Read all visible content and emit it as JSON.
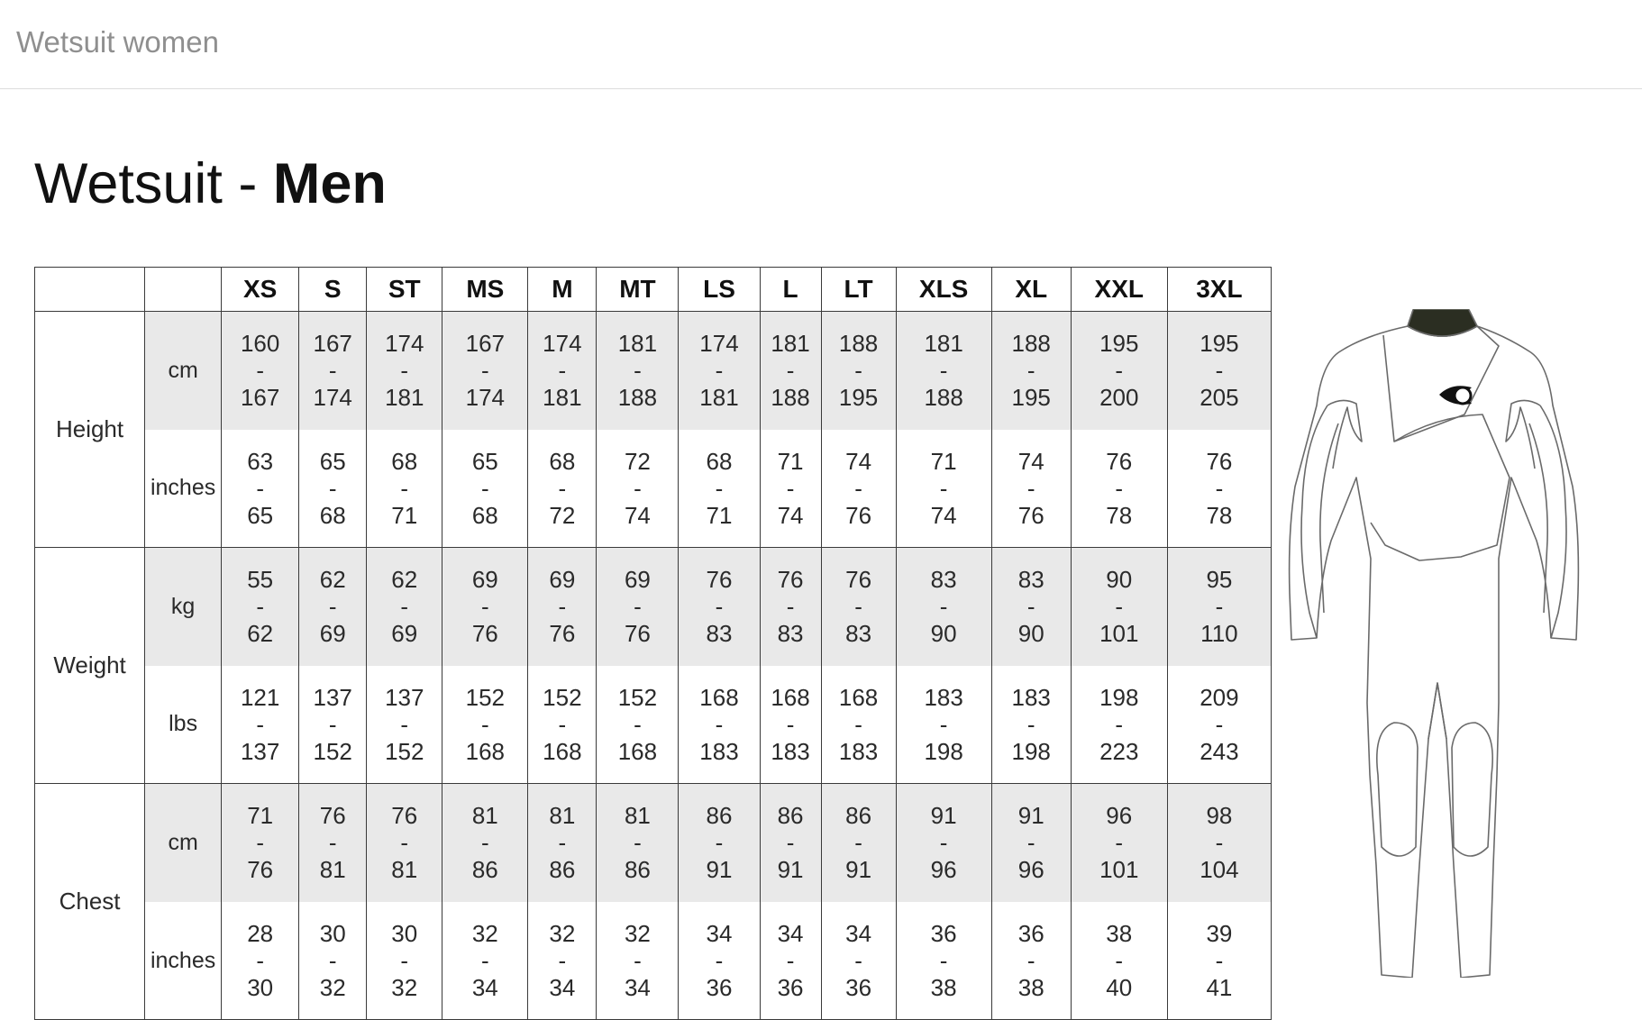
{
  "header": {
    "title": "Wetsuit women"
  },
  "page": {
    "title_prefix": "Wetsuit - ",
    "title_bold": "Men"
  },
  "table": {
    "sizes": [
      "XS",
      "S",
      "ST",
      "MS",
      "M",
      "MT",
      "LS",
      "L",
      "LT",
      "XLS",
      "XL",
      "XXL",
      "3XL"
    ],
    "groups": [
      {
        "label": "Height",
        "rows": [
          {
            "unit": "cm",
            "values": [
              [
                "160",
                "167"
              ],
              [
                "167",
                "174"
              ],
              [
                "174",
                "181"
              ],
              [
                "167",
                "174"
              ],
              [
                "174",
                "181"
              ],
              [
                "181",
                "188"
              ],
              [
                "174",
                "181"
              ],
              [
                "181",
                "188"
              ],
              [
                "188",
                "195"
              ],
              [
                "181",
                "188"
              ],
              [
                "188",
                "195"
              ],
              [
                "195",
                "200"
              ],
              [
                "195",
                "205"
              ]
            ]
          },
          {
            "unit": "inches",
            "values": [
              [
                "63",
                "65"
              ],
              [
                "65",
                "68"
              ],
              [
                "68",
                "71"
              ],
              [
                "65",
                "68"
              ],
              [
                "68",
                "72"
              ],
              [
                "72",
                "74"
              ],
              [
                "68",
                "71"
              ],
              [
                "71",
                "74"
              ],
              [
                "74",
                "76"
              ],
              [
                "71",
                "74"
              ],
              [
                "74",
                "76"
              ],
              [
                "76",
                "78"
              ],
              [
                "76",
                "78"
              ]
            ]
          }
        ]
      },
      {
        "label": "Weight",
        "rows": [
          {
            "unit": "kg",
            "values": [
              [
                "55",
                "62"
              ],
              [
                "62",
                "69"
              ],
              [
                "62",
                "69"
              ],
              [
                "69",
                "76"
              ],
              [
                "69",
                "76"
              ],
              [
                "69",
                "76"
              ],
              [
                "76",
                "83"
              ],
              [
                "76",
                "83"
              ],
              [
                "76",
                "83"
              ],
              [
                "83",
                "90"
              ],
              [
                "83",
                "90"
              ],
              [
                "90",
                "101"
              ],
              [
                "95",
                "110"
              ]
            ]
          },
          {
            "unit": "lbs",
            "values": [
              [
                "121",
                "137"
              ],
              [
                "137",
                "152"
              ],
              [
                "137",
                "152"
              ],
              [
                "152",
                "168"
              ],
              [
                "152",
                "168"
              ],
              [
                "152",
                "168"
              ],
              [
                "168",
                "183"
              ],
              [
                "168",
                "183"
              ],
              [
                "168",
                "183"
              ],
              [
                "183",
                "198"
              ],
              [
                "183",
                "198"
              ],
              [
                "198",
                "223"
              ],
              [
                "209",
                "243"
              ]
            ]
          }
        ]
      },
      {
        "label": "Chest",
        "rows": [
          {
            "unit": "cm",
            "values": [
              [
                "71",
                "76"
              ],
              [
                "76",
                "81"
              ],
              [
                "76",
                "81"
              ],
              [
                "81",
                "86"
              ],
              [
                "81",
                "86"
              ],
              [
                "81",
                "86"
              ],
              [
                "86",
                "91"
              ],
              [
                "86",
                "91"
              ],
              [
                "86",
                "91"
              ],
              [
                "91",
                "96"
              ],
              [
                "91",
                "96"
              ],
              [
                "96",
                "101"
              ],
              [
                "98",
                "104"
              ]
            ]
          },
          {
            "unit": "inches",
            "values": [
              [
                "28",
                "30"
              ],
              [
                "30",
                "32"
              ],
              [
                "30",
                "32"
              ],
              [
                "32",
                "34"
              ],
              [
                "32",
                "34"
              ],
              [
                "32",
                "34"
              ],
              [
                "34",
                "36"
              ],
              [
                "34",
                "36"
              ],
              [
                "34",
                "36"
              ],
              [
                "36",
                "38"
              ],
              [
                "36",
                "38"
              ],
              [
                "38",
                "40"
              ],
              [
                "39",
                "41"
              ]
            ]
          }
        ]
      }
    ],
    "separator": "-"
  },
  "illustration": {
    "icon": "wetsuit-icon",
    "accent": "#2b2e22",
    "outline": "#555555"
  }
}
